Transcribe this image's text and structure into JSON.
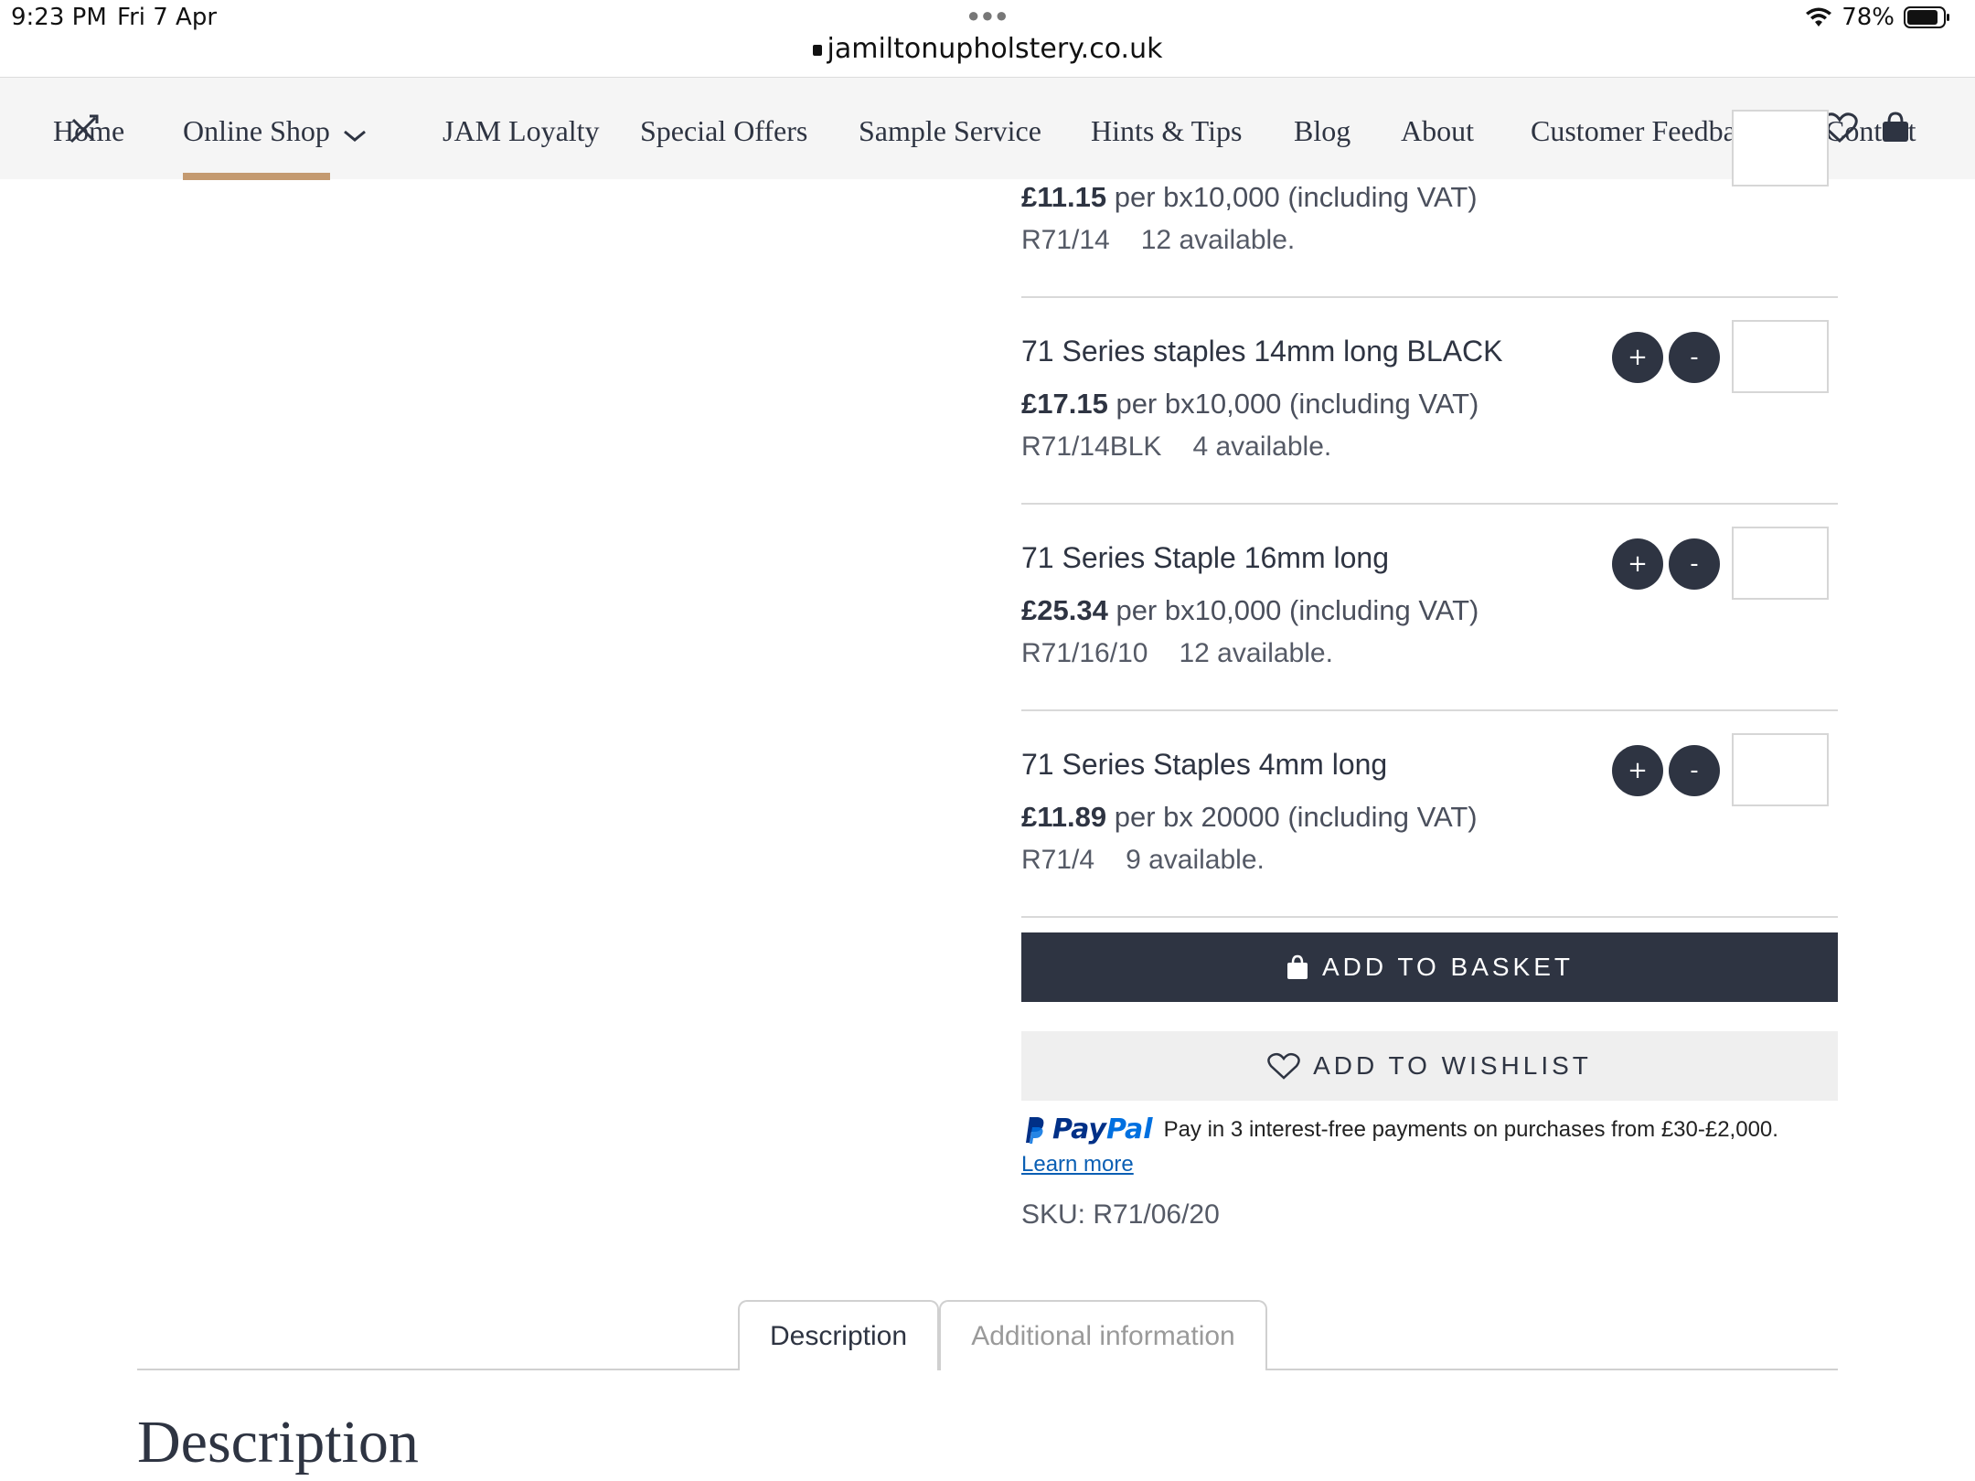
{
  "status_bar": {
    "time": "9:23 PM",
    "date": "Fri 7 Apr",
    "url": "jamiltonupholstery.co.uk",
    "battery": "78%"
  },
  "nav": {
    "items": [
      {
        "label": "Home"
      },
      {
        "label": "Online Shop"
      },
      {
        "label": "JAM Loyalty"
      },
      {
        "label": "Special Offers"
      },
      {
        "label": "Sample Service"
      },
      {
        "label": "Hints & Tips"
      },
      {
        "label": "Blog"
      },
      {
        "label": "About"
      },
      {
        "label": "Customer Feedback"
      },
      {
        "label": "Contact"
      }
    ],
    "active": "Online Shop"
  },
  "products": [
    {
      "title": "",
      "price": "£11.15",
      "price_unit": "per bx10,000 (including VAT)",
      "code": "R71/14",
      "availability": "12 available."
    },
    {
      "title": "71 Series staples 14mm long BLACK",
      "price": "£17.15",
      "price_unit": "per bx10,000 (including VAT)",
      "code": "R71/14BLK",
      "availability": "4 available."
    },
    {
      "title": "71 Series Staple 16mm long",
      "price": "£25.34",
      "price_unit": "per bx10,000 (including VAT)",
      "code": "R71/16/10",
      "availability": "12 available."
    },
    {
      "title": "71 Series Staples 4mm long",
      "price": "£11.89",
      "price_unit": "per bx 20000 (including VAT)",
      "code": "R71/4",
      "availability": "9 available."
    }
  ],
  "qty": {
    "plus": "+",
    "minus": "-"
  },
  "buttons": {
    "add_to_basket": "ADD TO BASKET",
    "add_to_wishlist": "ADD TO WISHLIST"
  },
  "paypal": {
    "brand_pay": "Pay",
    "brand_pal": "Pal",
    "message": "Pay in 3 interest-free payments on purchases from £30-£2,000.",
    "learn_more": "Learn more"
  },
  "sku": "SKU: R71/06/20",
  "tabs": [
    {
      "label": "Description"
    },
    {
      "label": "Additional information"
    }
  ],
  "description_heading": "Description",
  "colors": {
    "navy": "#2e3442",
    "accent_underline": "#c49a70",
    "paypal_blue": "#003087"
  }
}
